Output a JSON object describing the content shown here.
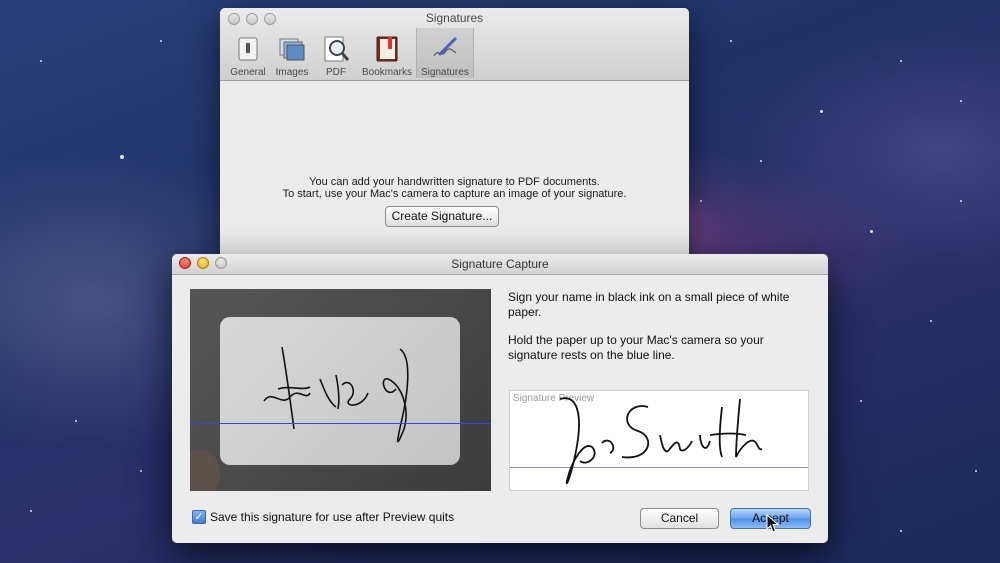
{
  "prefs_window": {
    "title": "Signatures",
    "toolbar": [
      {
        "label": "General",
        "icon": "general-switch-icon"
      },
      {
        "label": "Images",
        "icon": "images-stack-icon"
      },
      {
        "label": "PDF",
        "icon": "pdf-magnifier-icon"
      },
      {
        "label": "Bookmarks",
        "icon": "bookmarks-book-icon"
      },
      {
        "label": "Signatures",
        "icon": "signature-pen-icon",
        "selected": true
      }
    ],
    "message_line1": "You can add your handwritten signature to PDF documents.",
    "message_line2": "To start, use your Mac's camera to capture an image of your signature.",
    "create_button": "Create Signature..."
  },
  "capture_window": {
    "title": "Signature Capture",
    "instruction1": "Sign your name in black ink on a small piece of white paper.",
    "instruction2": "Hold the paper up to your Mac's camera so your signature rests on the blue line.",
    "preview_label": "Signature Preview",
    "save_checkbox_label": "Save this signature for use after Preview quits",
    "save_checked": true,
    "cancel_button": "Cancel",
    "accept_button": "Accept"
  },
  "colors": {
    "guide_line_camera": "#3a46d8",
    "guide_line_preview": "#8a8fcf",
    "default_button": "#6aa3ef"
  }
}
